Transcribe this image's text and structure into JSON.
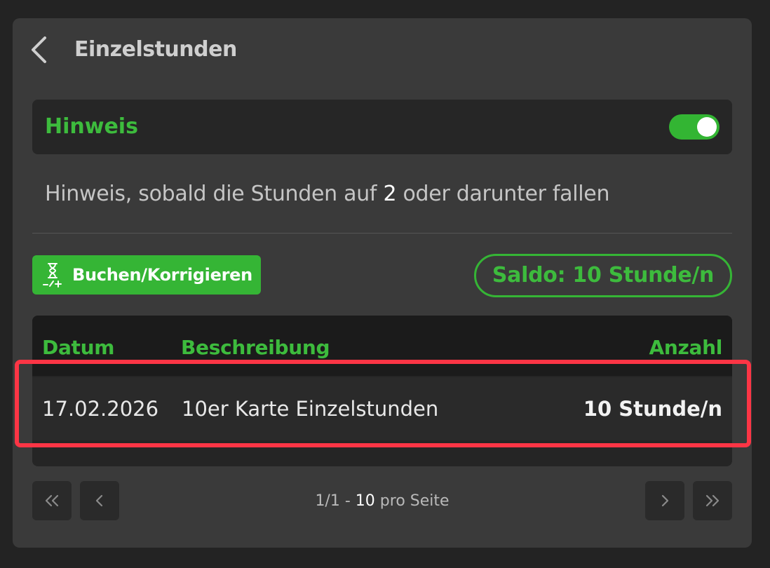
{
  "header": {
    "title": "Einzelstunden"
  },
  "hint": {
    "title": "Hinweis",
    "toggle_on": true,
    "text_before": "Hinweis, sobald die Stunden auf",
    "threshold": "2",
    "text_after": "oder darunter fallen"
  },
  "actions": {
    "book_label": "Buchen/Korrigieren",
    "saldo_label": "Saldo: 10 Stunde/n"
  },
  "table": {
    "columns": {
      "date": "Datum",
      "description": "Beschreibung",
      "amount": "Anzahl"
    },
    "rows": [
      {
        "date": "17.02.2026",
        "description": "10er Karte Einzelstunden",
        "amount": "10 Stunde/n"
      }
    ]
  },
  "pagination": {
    "page": "1/1",
    "separator": "-",
    "per_page": "10",
    "per_page_label": "pro Seite"
  },
  "colors": {
    "accent": "#35b535",
    "highlight": "#fc3545",
    "background": "#3a3a3a"
  },
  "icons": {
    "back": "chevron-left-icon",
    "book": "hourglass-plus-minus-icon",
    "first": "double-chevron-left-icon",
    "prev": "chevron-left-icon",
    "next": "chevron-right-icon",
    "last": "double-chevron-right-icon"
  }
}
